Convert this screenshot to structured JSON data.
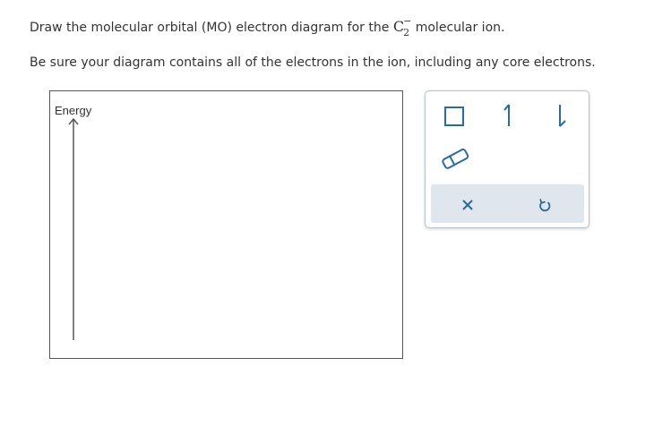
{
  "prompt": {
    "line1_before": "Draw the molecular orbital (MO) electron diagram for the ",
    "formula_element": "C",
    "formula_subscript": "2",
    "formula_charge": "−",
    "line1_after": " molecular ion.",
    "line2": "Be sure your diagram contains all of the electrons in the ion, including any core electrons."
  },
  "diagram": {
    "energy_label": "Energy"
  },
  "toolbox": {
    "tools": [
      "orbital-box",
      "spin-up-arrow",
      "spin-down-arrow",
      "eraser"
    ],
    "actions": [
      "clear",
      "undo"
    ],
    "icon_color": "#2b6a9a",
    "action_bar_color": "#dfe6ed"
  }
}
